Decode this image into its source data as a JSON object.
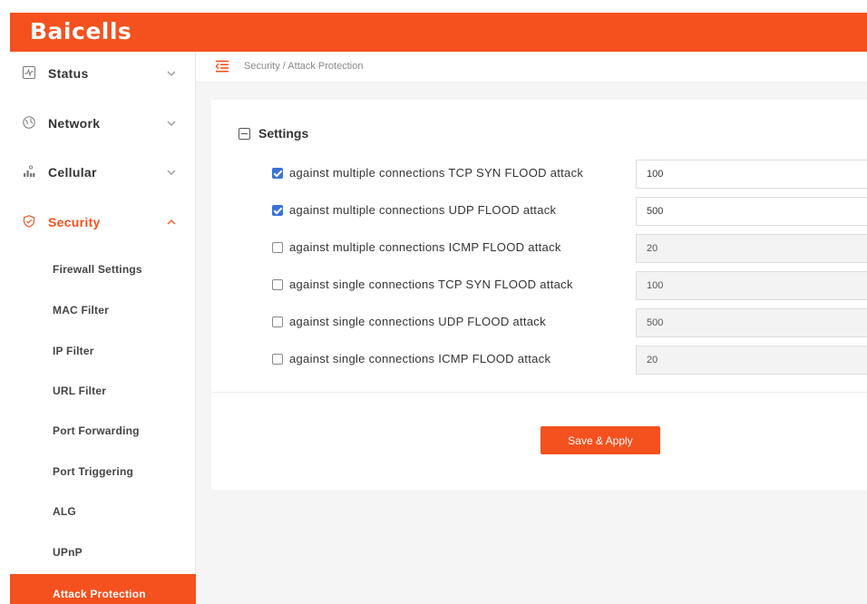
{
  "brand": {
    "logo_text": "Baicells",
    "accent_color": "#f4511e"
  },
  "sidebar": {
    "menus": [
      {
        "label": "Status",
        "icon": "activity-icon",
        "expanded": false
      },
      {
        "label": "Network",
        "icon": "globe-icon",
        "expanded": false
      },
      {
        "label": "Cellular",
        "icon": "signal-bars-icon",
        "expanded": false
      },
      {
        "label": "Security",
        "icon": "shield-icon",
        "expanded": true
      }
    ],
    "security_items": [
      {
        "label": "Firewall Settings"
      },
      {
        "label": "MAC Filter"
      },
      {
        "label": "IP Filter"
      },
      {
        "label": "URL Filter"
      },
      {
        "label": "Port Forwarding"
      },
      {
        "label": "Port Triggering"
      },
      {
        "label": "ALG"
      },
      {
        "label": "UPnP"
      },
      {
        "label": "Attack Protection",
        "active": true
      }
    ]
  },
  "header": {
    "breadcrumb": "Security / Attack Protection"
  },
  "settings": {
    "title": "Settings",
    "rows": [
      {
        "label": "against multiple connections TCP SYN FLOOD attack",
        "checked": true,
        "value": "100"
      },
      {
        "label": "against multiple connections UDP FLOOD attack",
        "checked": true,
        "value": "500"
      },
      {
        "label": "against multiple connections ICMP FLOOD attack",
        "checked": false,
        "value": "20"
      },
      {
        "label": "against single connections TCP SYN FLOOD attack",
        "checked": false,
        "value": "100"
      },
      {
        "label": "against single connections UDP FLOOD attack",
        "checked": false,
        "value": "500"
      },
      {
        "label": "against single connections ICMP FLOOD attack",
        "checked": false,
        "value": "20"
      }
    ],
    "save_label": "Save & Apply"
  }
}
